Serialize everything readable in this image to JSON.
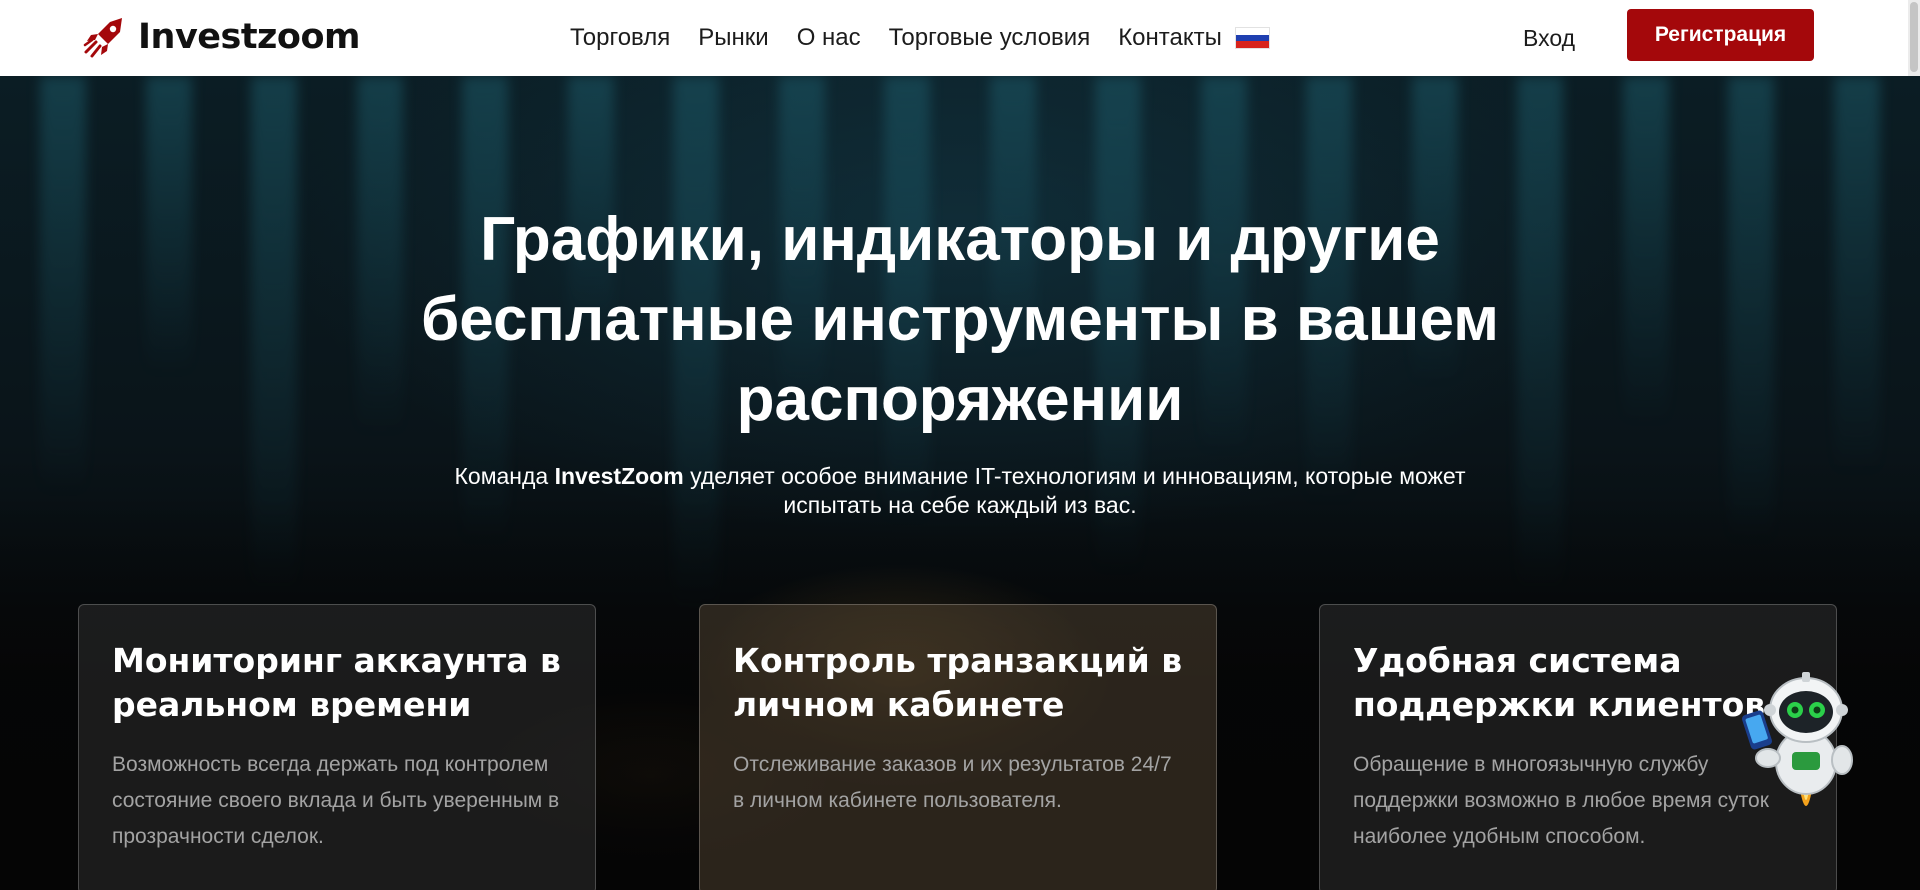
{
  "brand": {
    "name": "Investzoom",
    "accent": "#a4080b"
  },
  "nav": {
    "items": [
      {
        "label": "Торговля"
      },
      {
        "label": "Рынки"
      },
      {
        "label": "О нас"
      },
      {
        "label": "Торговые условия"
      },
      {
        "label": "Контакты"
      }
    ],
    "language_icon": "russian-flag-icon",
    "login_label": "Вход",
    "register_label": "Регистрация"
  },
  "hero": {
    "title": "Графики, индикаторы и другие бесплатные инструменты в вашем распоряжении",
    "subtitle_before": "Команда ",
    "subtitle_bold": "InvestZoom",
    "subtitle_after": " уделяет особое внимание IT-технологиям и инновациям, которые может испытать на себе каждый из вас."
  },
  "features": [
    {
      "title": "Мониторинг аккаунта в реальном времени",
      "text": "Возможность всегда держать под контролем состояние своего вклада и быть уверенным в прозрачности сделок."
    },
    {
      "title": "Контроль транзакций в личном кабинете",
      "text": "Отслеживание заказов и их результатов 24/7 в личном кабинете пользователя."
    },
    {
      "title": "Удобная система поддержки клиентов",
      "text": "Обращение в многоязычную службу поддержки возможно в любое время суток наиболее удобным способом."
    }
  ],
  "chat_widget": {
    "icon": "robot-assistant-icon"
  }
}
